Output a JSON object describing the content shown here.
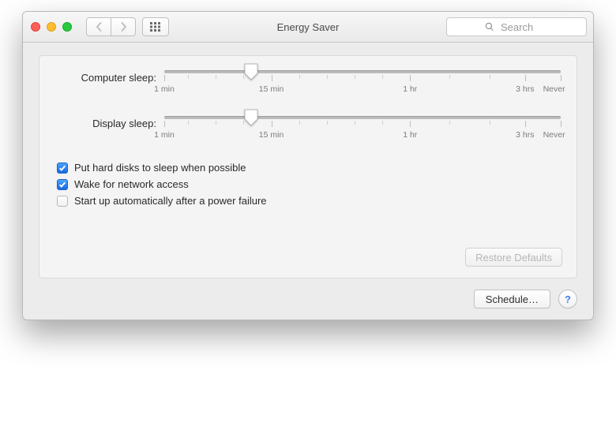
{
  "window": {
    "title": "Energy Saver"
  },
  "search": {
    "placeholder": "Search"
  },
  "sliders": {
    "computer": {
      "label": "Computer sleep:",
      "value_pct": 22
    },
    "display": {
      "label": "Display sleep:",
      "value_pct": 22
    },
    "ticks": {
      "min": {
        "pos": 0,
        "label": "1 min"
      },
      "t15": {
        "pos": 27,
        "label": "15 min"
      },
      "t1h": {
        "pos": 62,
        "label": "1 hr"
      },
      "t3h": {
        "pos": 91,
        "label": "3 hrs"
      },
      "never": {
        "pos": 100,
        "label": "Never"
      }
    }
  },
  "checks": {
    "hd": {
      "label": "Put hard disks to sleep when possible",
      "checked": true
    },
    "wake": {
      "label": "Wake for network access",
      "checked": true
    },
    "start": {
      "label": "Start up automatically after a power failure",
      "checked": false
    }
  },
  "buttons": {
    "restore": "Restore Defaults",
    "schedule": "Schedule…",
    "help": "?"
  }
}
